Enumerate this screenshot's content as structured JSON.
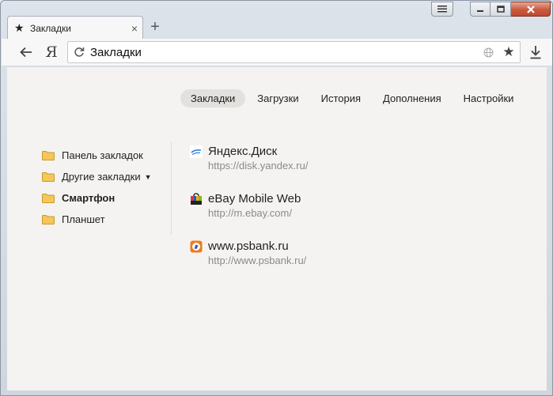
{
  "tab": {
    "title": "Закладки",
    "icon": "star-icon"
  },
  "omnibox": {
    "text": "Закладки"
  },
  "toolbar": {
    "ya_label": "Я"
  },
  "nav": {
    "items": [
      {
        "label": "Закладки",
        "active": true
      },
      {
        "label": "Загрузки"
      },
      {
        "label": "История"
      },
      {
        "label": "Дополнения"
      },
      {
        "label": "Настройки"
      }
    ]
  },
  "folders": [
    {
      "label": "Панель закладок"
    },
    {
      "label": "Другие закладки"
    },
    {
      "label": "Смартфон",
      "selected": true
    },
    {
      "label": "Планшет"
    }
  ],
  "bookmarks": [
    {
      "title": "Яндекс.Диск",
      "url": "https://disk.yandex.ru/",
      "icon": "yandex-disk-icon"
    },
    {
      "title": "eBay Mobile Web",
      "url": "http://m.ebay.com/",
      "icon": "ebay-icon"
    },
    {
      "title": "www.psbank.ru",
      "url": "http://www.psbank.ru/",
      "icon": "psbank-icon"
    }
  ],
  "colors": {
    "folder": "#f5c758",
    "content_bg": "#f4f3f1",
    "close_button": "#c85a3f"
  }
}
